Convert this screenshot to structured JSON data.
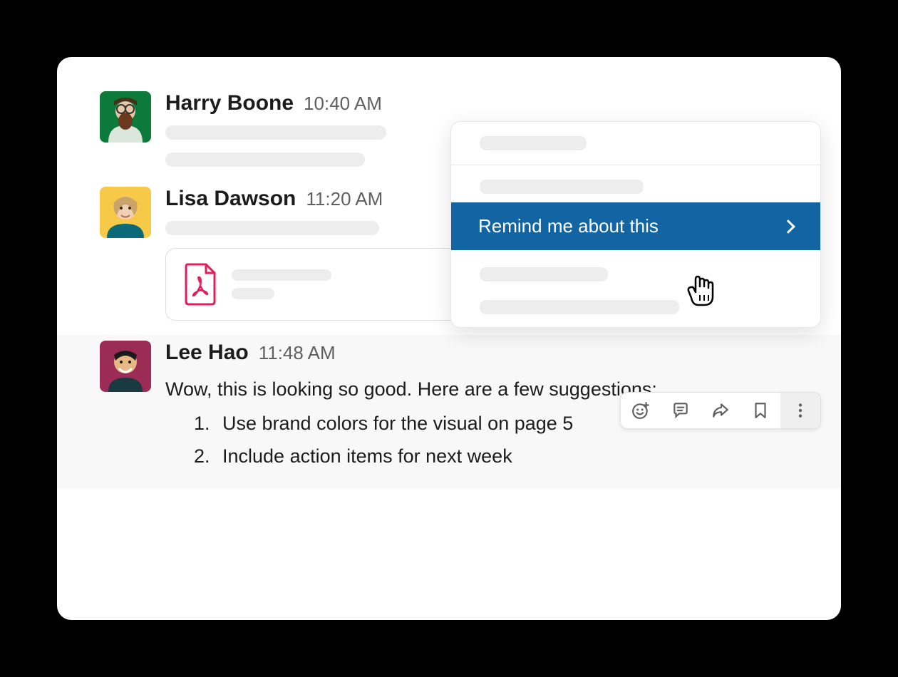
{
  "messages": [
    {
      "name": "Harry Boone",
      "time": "10:40 AM"
    },
    {
      "name": "Lisa Dawson",
      "time": "11:20 AM"
    },
    {
      "name": "Lee Hao",
      "time": "11:48 AM",
      "body_intro": "Wow, this is looking so good. Here are a few suggestions:",
      "list": [
        "Use brand colors for the visual on page 5",
        "Include action items for next week"
      ]
    }
  ],
  "context_menu": {
    "active_item": "Remind me about this"
  },
  "toolbar_icons": {
    "emoji": "add-reaction-icon",
    "thread": "thread-icon",
    "share": "share-icon",
    "bookmark": "bookmark-icon",
    "more": "more-actions-icon"
  },
  "attachment": {
    "type": "pdf"
  }
}
